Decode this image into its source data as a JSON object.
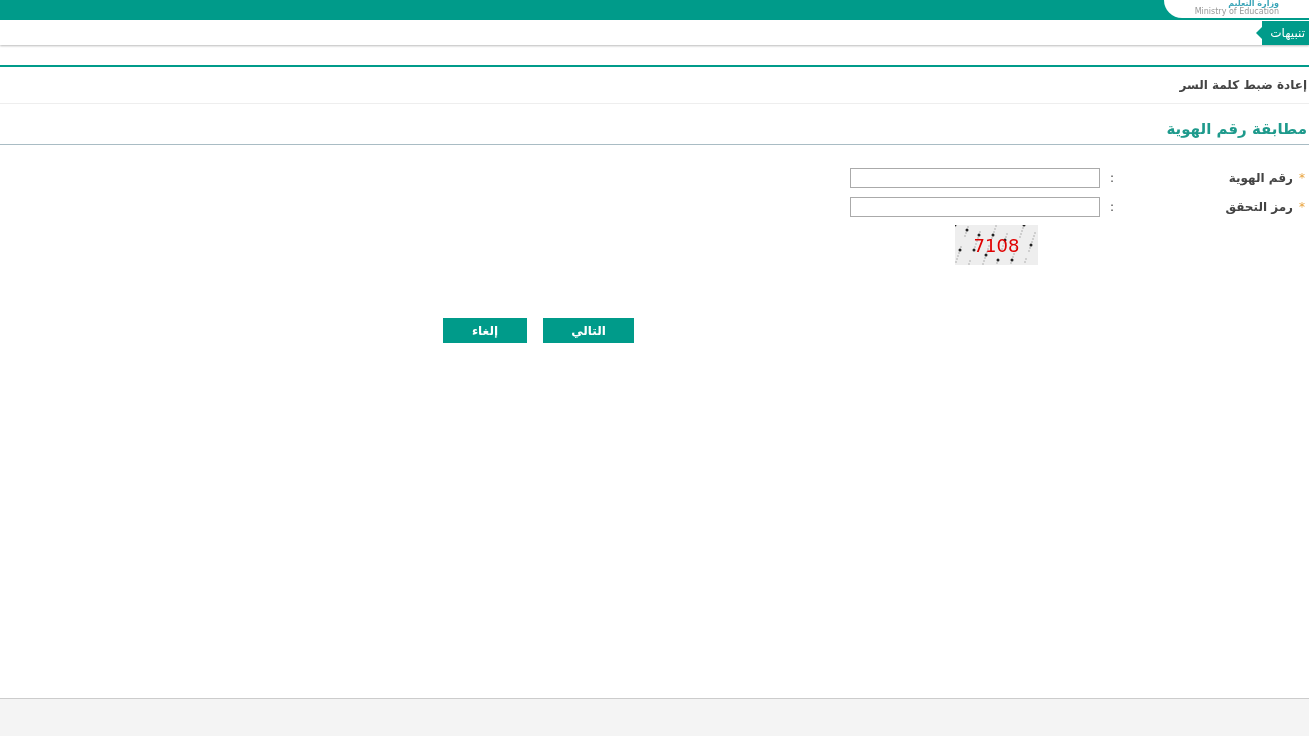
{
  "header": {
    "logo_arabic": "وزارة التعليم",
    "logo_english": "Ministry of Education"
  },
  "notifications_tab": {
    "label": "تنبيهات"
  },
  "page_title": "إعادة ضبط كلمة السر",
  "section_title": "مطابقة رقم الهوية",
  "fields": [
    {
      "label": "رقم الهوية",
      "required": true,
      "separator": ":"
    },
    {
      "label": "رمز التحقق",
      "required": true,
      "separator": ":"
    }
  ],
  "required_mark": "*",
  "captcha": {
    "code": "7108"
  },
  "buttons": [
    {
      "label": "التالي"
    },
    {
      "label": "إلغاء"
    }
  ]
}
